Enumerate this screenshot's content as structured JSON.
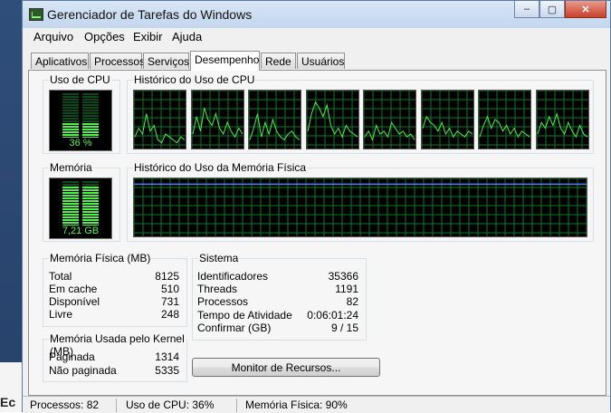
{
  "window": {
    "title": "Gerenciador de Tarefas do Windows",
    "close_glyph": "✕",
    "min_glyph": "–",
    "max_glyph": "▢"
  },
  "desktop": {
    "partial_label": "Ec"
  },
  "menu": [
    "Arquivo",
    "Opções",
    "Exibir",
    "Ajuda"
  ],
  "tabs": [
    "Aplicativos",
    "Processos",
    "Serviços",
    "Desempenho",
    "Rede",
    "Usuários"
  ],
  "active_tab": "Desempenho",
  "cpu": {
    "usage_label": "Uso de CPU",
    "usage_value": "36 %",
    "usage_percent": 36,
    "history_label": "Histórico do Uso de CPU",
    "core_history": [
      [
        20,
        35,
        25,
        60,
        30,
        40,
        15,
        10,
        25,
        20,
        15,
        10,
        20,
        15
      ],
      [
        25,
        55,
        30,
        70,
        50,
        40,
        60,
        35,
        25,
        45,
        30,
        20,
        35,
        25
      ],
      [
        15,
        35,
        60,
        20,
        45,
        25,
        50,
        30,
        20,
        15,
        25,
        30,
        20,
        15
      ],
      [
        30,
        60,
        80,
        70,
        55,
        75,
        40,
        25,
        35,
        20,
        40,
        30,
        25,
        20
      ],
      [
        20,
        30,
        15,
        40,
        25,
        30,
        20,
        45,
        35,
        25,
        30,
        20,
        25,
        15
      ],
      [
        35,
        55,
        45,
        40,
        30,
        45,
        25,
        35,
        20,
        30,
        25,
        20,
        30,
        25
      ],
      [
        20,
        40,
        55,
        35,
        50,
        45,
        30,
        40,
        25,
        35,
        20,
        30,
        25,
        20
      ],
      [
        25,
        45,
        35,
        55,
        40,
        60,
        35,
        25,
        45,
        30,
        20,
        40,
        25,
        20
      ]
    ]
  },
  "memory": {
    "label": "Memória",
    "value": "7,21 GB",
    "usage_percent": 90,
    "history_label": "Histórico do Uso da Memória Física",
    "history_level_percent": 90
  },
  "physical_memory": {
    "title": "Memória Física (MB)",
    "rows": [
      {
        "label": "Total",
        "value": "8125"
      },
      {
        "label": "Em cache",
        "value": "510"
      },
      {
        "label": "Disponível",
        "value": "731"
      },
      {
        "label": "Livre",
        "value": "248"
      }
    ]
  },
  "kernel_memory": {
    "title": "Memória Usada pelo Kernel (MB)",
    "rows": [
      {
        "label": "Paginada",
        "value": "1314"
      },
      {
        "label": "Não paginada",
        "value": "5335"
      }
    ]
  },
  "system": {
    "title": "Sistema",
    "rows": [
      {
        "label": "Identificadores",
        "value": "35366"
      },
      {
        "label": "Threads",
        "value": "1191"
      },
      {
        "label": "Processos",
        "value": "82"
      },
      {
        "label": "Tempo de Atividade",
        "value": "0:06:01:24"
      },
      {
        "label": "Confirmar (GB)",
        "value": "9 / 15"
      }
    ]
  },
  "resource_monitor_button": "Monitor de Recursos...",
  "status": {
    "processes": "Processos: 82",
    "cpu": "Uso de CPU: 36%",
    "memory": "Memória Física: 90%"
  },
  "colors": {
    "graph_green": "#4ff04a",
    "grid_green": "#0b7a2e",
    "memory_line": "#4f7ff2"
  }
}
